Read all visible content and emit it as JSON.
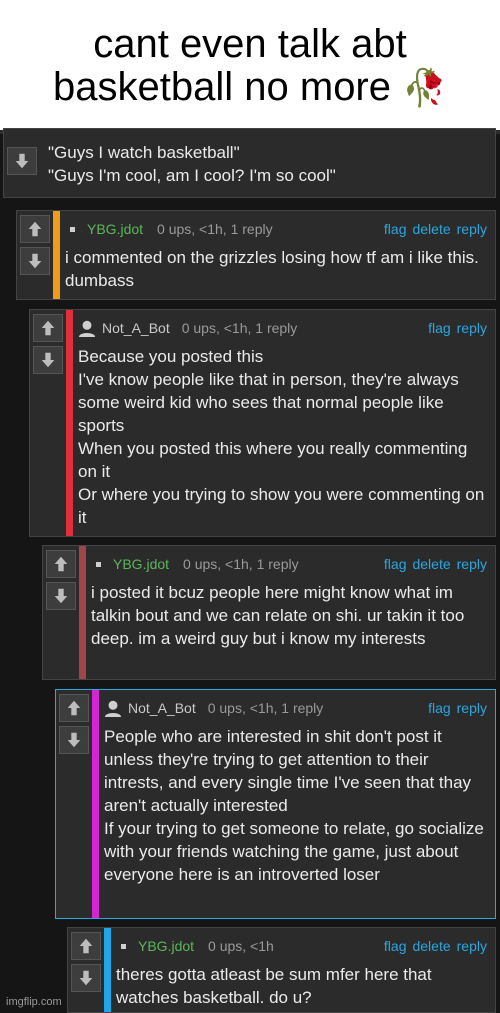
{
  "caption": {
    "text": "cant even talk abt basketball no more",
    "emoji": "🥀"
  },
  "links": {
    "flag": "flag",
    "delete": "delete",
    "reply": "reply"
  },
  "comments": [
    {
      "username": "",
      "meta": "",
      "text": "\"Guys I watch basketball\"\n\"Guys I'm cool, am I cool? I'm so cool\"",
      "bar_color": "#2b2b2b"
    },
    {
      "username": "YBG.jdot",
      "meta": "0 ups, <1h, 1 reply",
      "text": "i commented on the grizzles losing how tf am i like this. dumbass",
      "bar_color": "#f29a1a"
    },
    {
      "username": "Not_A_Bot",
      "meta": "0 ups, <1h, 1 reply",
      "text": "Because you posted this\nI've know people like that in person, they're always some weird kid who sees that normal people like sports\nWhen you posted this where you really commenting on it\nOr where you trying to show you were commenting on it",
      "bar_color": "#e0303c"
    },
    {
      "username": "YBG.jdot",
      "meta": "0 ups, <1h, 1 reply",
      "text": "i posted it bcuz people here might know what im talkin bout and we can relate on shi. ur takin it too deep. im a weird guy but i know my interests",
      "bar_color": "#a0454a"
    },
    {
      "username": "Not_A_Bot",
      "meta": "0 ups, <1h, 1 reply",
      "text": "People who are interested in shit don't post it unless they're trying to get attention to their intrests, and every single time I've seen that thay aren't actually interested\nIf your trying to get someone to relate, go socialize with your friends watching the game, just about everyone here is an introverted loser",
      "bar_color": "#d424d4"
    },
    {
      "username": "YBG.jdot",
      "meta": "0 ups, <1h",
      "text": "theres gotta atleast be sum mfer here that watches basketball. do u?",
      "bar_color": "#1ea6e8"
    }
  ],
  "watermark": "imgflip.com"
}
